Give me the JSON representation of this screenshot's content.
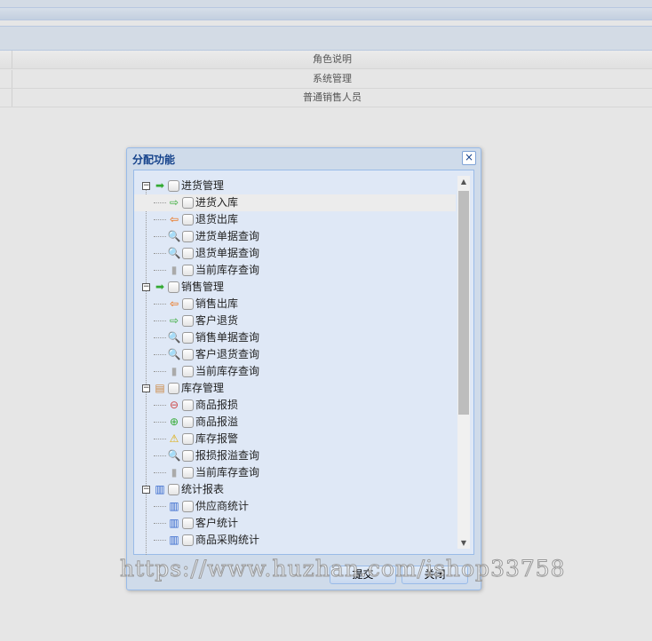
{
  "grid": {
    "header": "角色说明",
    "rows": [
      "系统管理",
      "普通销售人员"
    ]
  },
  "dialog": {
    "title": "分配功能",
    "close": "×",
    "submit": "提交",
    "cancel": "关闭",
    "tree": [
      {
        "label": "进货管理",
        "icon": "folder-in-icon",
        "children": [
          {
            "label": "进货入库",
            "icon": "arrow-right-icon",
            "selected": true
          },
          {
            "label": "退货出库",
            "icon": "arrow-left-icon"
          },
          {
            "label": "进货单据查询",
            "icon": "doc-search-icon"
          },
          {
            "label": "退货单据查询",
            "icon": "doc-search-icon"
          },
          {
            "label": "当前库存查询",
            "icon": "database-icon"
          }
        ]
      },
      {
        "label": "销售管理",
        "icon": "folder-in-icon",
        "children": [
          {
            "label": "销售出库",
            "icon": "arrow-left-icon"
          },
          {
            "label": "客户退货",
            "icon": "arrow-right-icon"
          },
          {
            "label": "销售单据查询",
            "icon": "doc-search-icon"
          },
          {
            "label": "客户退货查询",
            "icon": "doc-search-icon"
          },
          {
            "label": "当前库存查询",
            "icon": "database-icon"
          }
        ]
      },
      {
        "label": "库存管理",
        "icon": "box-icon",
        "children": [
          {
            "label": "商品报损",
            "icon": "db-minus-icon"
          },
          {
            "label": "商品报溢",
            "icon": "db-plus-icon"
          },
          {
            "label": "库存报警",
            "icon": "warning-icon"
          },
          {
            "label": "报损报溢查询",
            "icon": "doc-search-icon"
          },
          {
            "label": "当前库存查询",
            "icon": "database-icon"
          }
        ]
      },
      {
        "label": "统计报表",
        "icon": "bar-chart-icon",
        "children": [
          {
            "label": "供应商统计",
            "icon": "report-icon"
          },
          {
            "label": "客户统计",
            "icon": "report-icon"
          },
          {
            "label": "商品采购统计",
            "icon": "report-icon"
          }
        ]
      }
    ]
  },
  "watermark": "https://www.huzhan.com/ishop33758"
}
